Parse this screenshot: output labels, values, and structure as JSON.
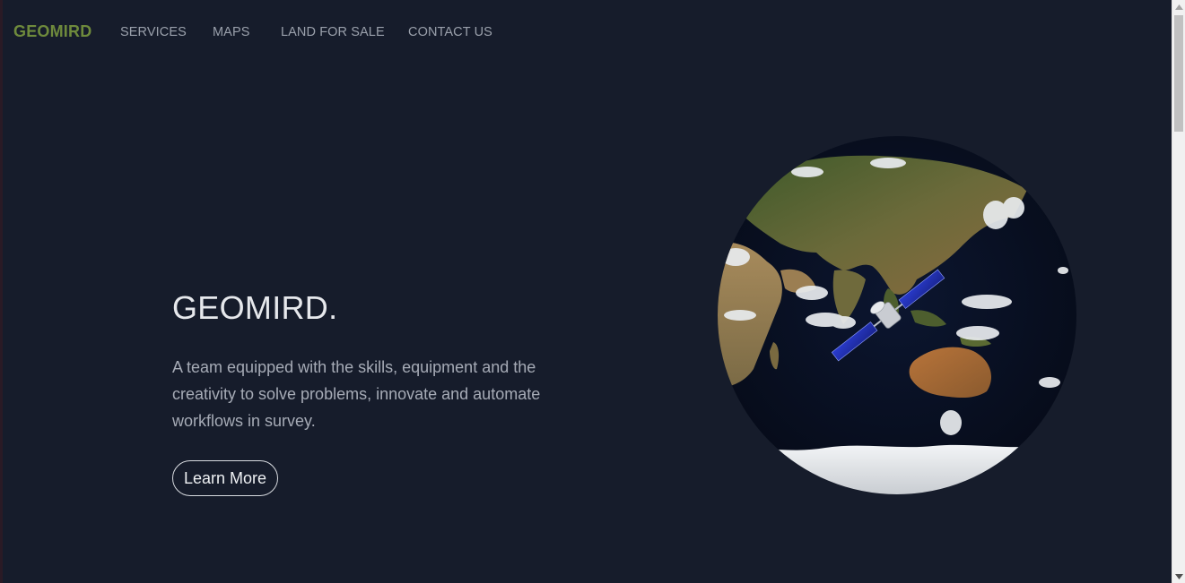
{
  "nav": {
    "brand": "GEOMIRD",
    "links": [
      "SERVICES",
      "MAPS",
      "LAND FOR SALE",
      "CONTACT US"
    ]
  },
  "hero": {
    "title": "GEOMIRD.",
    "description": "A team equipped with the skills, equipment and the creativity to solve problems, innovate and automate workflows in survey.",
    "button_label": "Learn More"
  },
  "colors": {
    "background": "#161c2b",
    "brand": "#6e8a3c",
    "nav_text": "#9aa0ab",
    "title_text": "#e6e8ec",
    "body_text": "#a6abb6"
  },
  "icons": {
    "globe": "earth-globe-with-satellite",
    "scroll_up": "triangle-up-icon",
    "scroll_down": "triangle-down-icon"
  }
}
